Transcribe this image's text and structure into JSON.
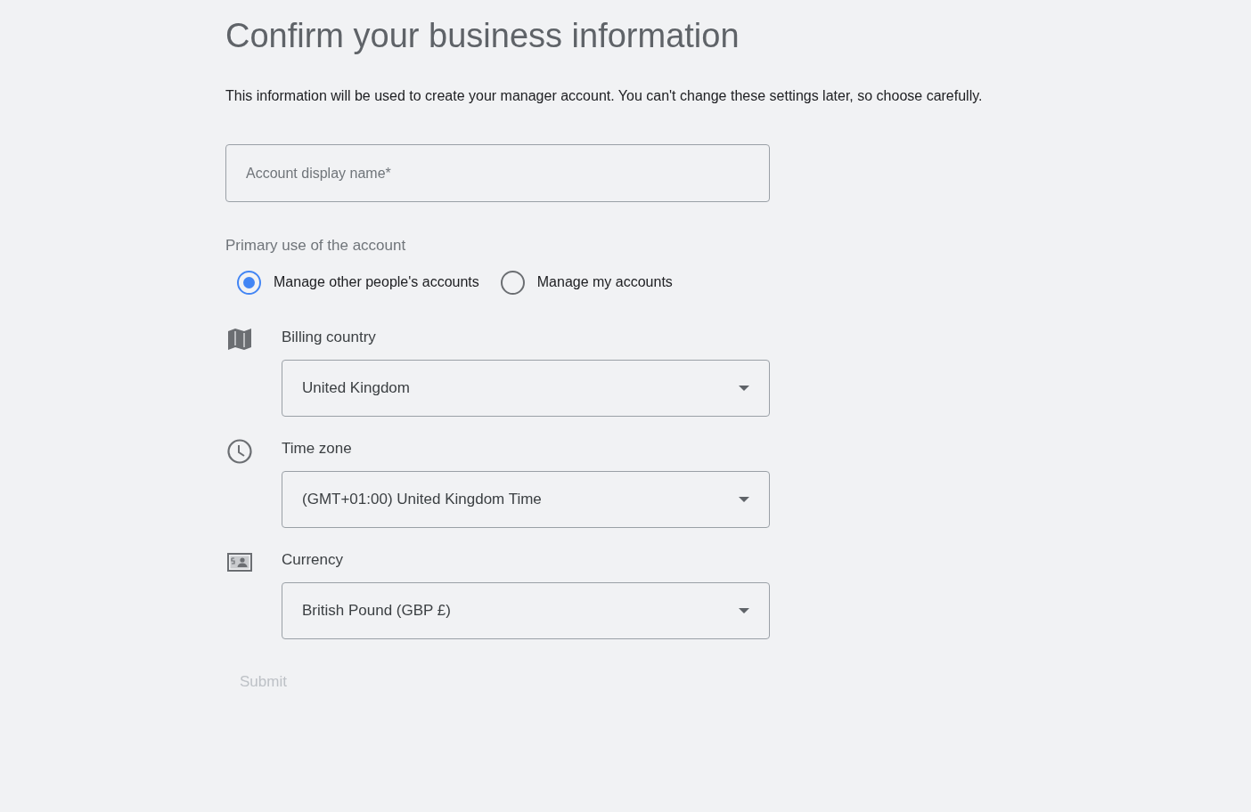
{
  "page": {
    "title": "Confirm your business information",
    "description": "This information will be used to create your manager account. You can't change these settings later, so choose carefully."
  },
  "display_name_field": {
    "placeholder": "Account display name*"
  },
  "primary_use": {
    "label": "Primary use of the account",
    "options": [
      {
        "label": "Manage other people's accounts",
        "selected": true
      },
      {
        "label": "Manage my accounts",
        "selected": false
      }
    ]
  },
  "settings": [
    {
      "kind": "country",
      "label": "Billing country",
      "value": "United Kingdom"
    },
    {
      "kind": "timezone",
      "label": "Time zone",
      "value": "(GMT+01:00) United Kingdom Time"
    },
    {
      "kind": "currency",
      "label": "Currency",
      "value": "British Pound (GBP £)"
    }
  ],
  "submit": {
    "label": "Submit",
    "disabled": true
  }
}
